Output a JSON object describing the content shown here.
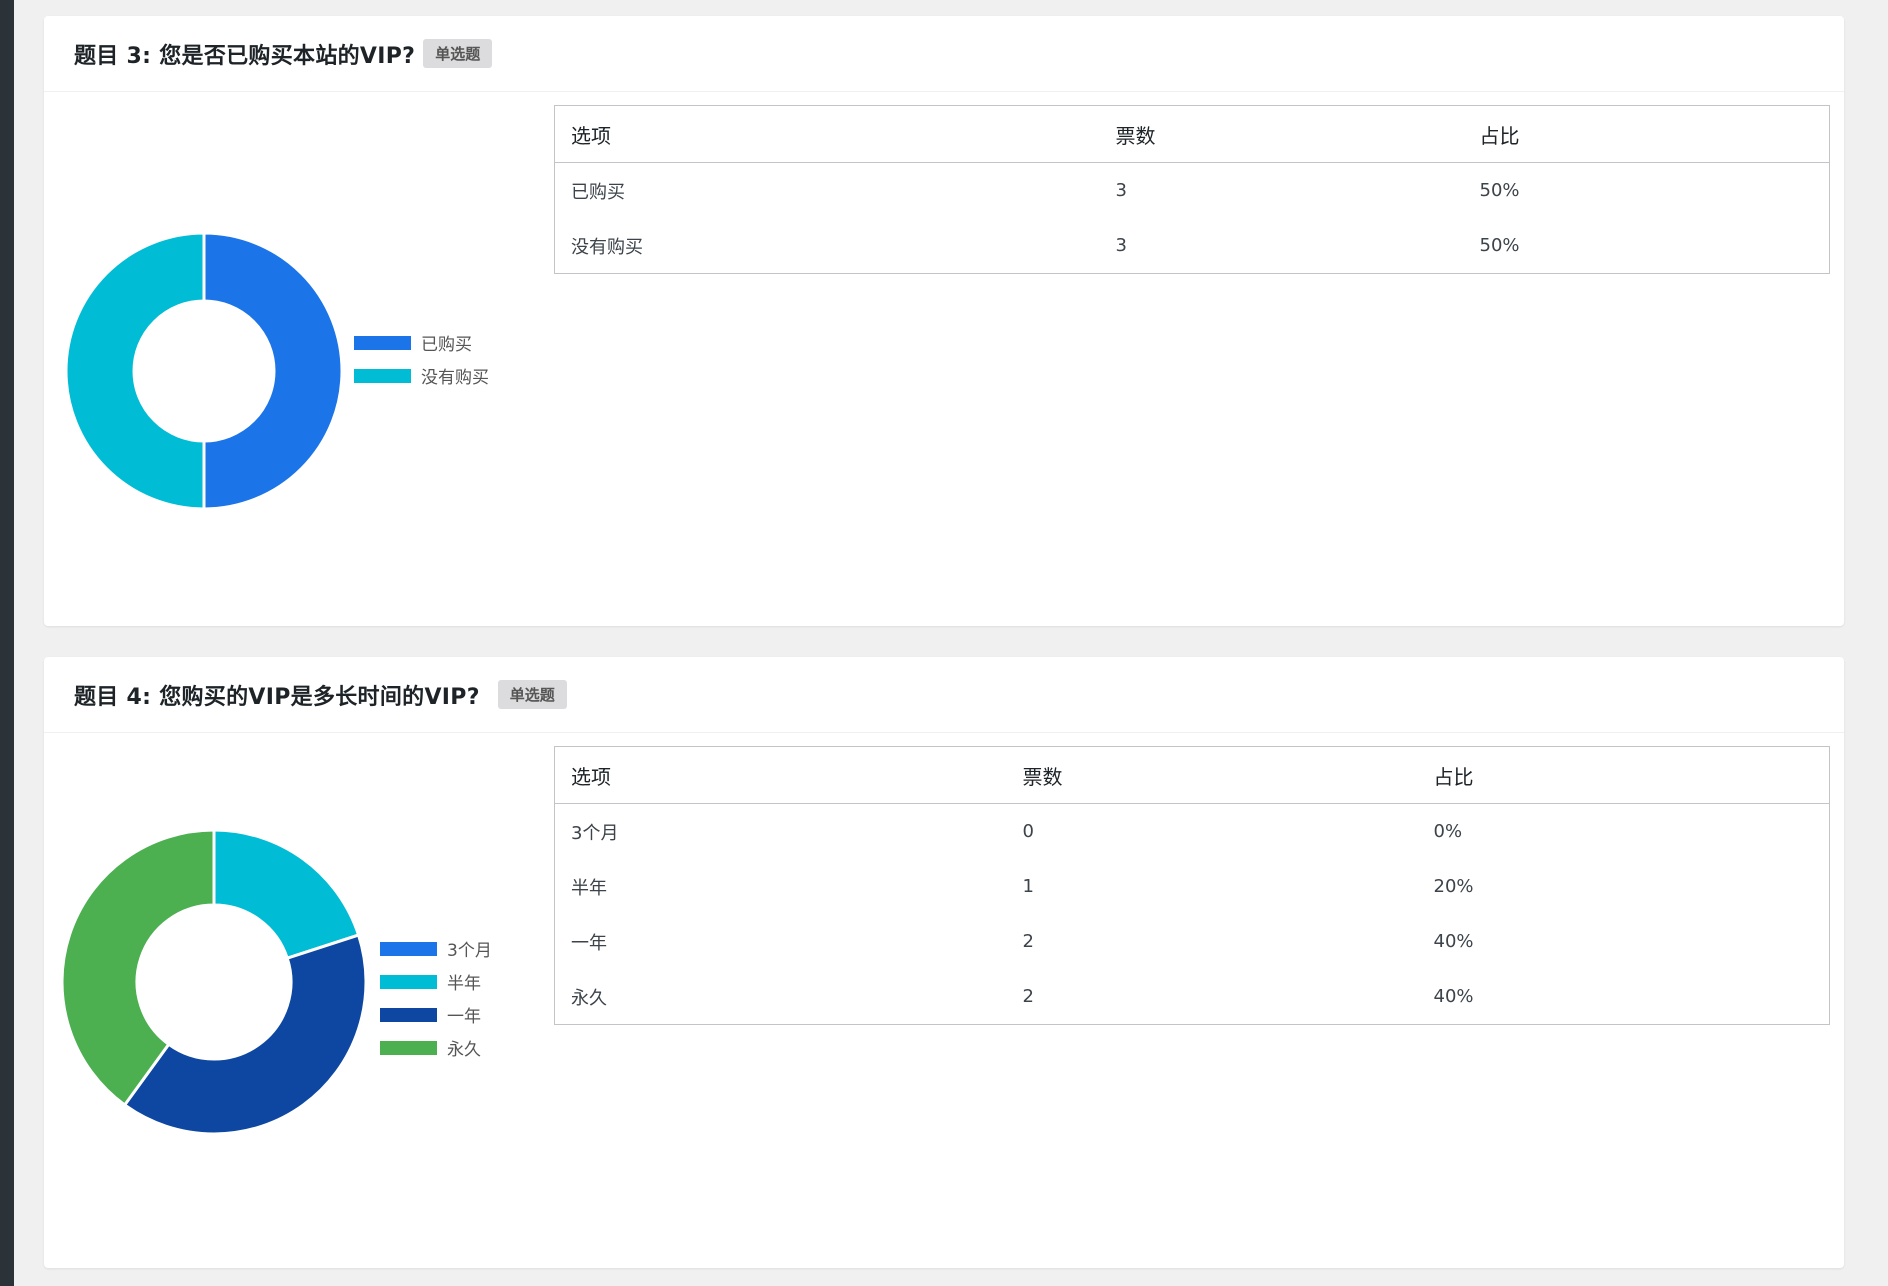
{
  "questions": [
    {
      "title": "题目 3: 您是否已购买本站的VIP?",
      "tag": "单选题",
      "table": {
        "headers": [
          "选项",
          "票数",
          "占比"
        ],
        "rows": [
          [
            "已购买",
            "3",
            "50%"
          ],
          [
            "没有购买",
            "3",
            "50%"
          ]
        ]
      },
      "chart_data": {
        "type": "pie",
        "categories": [
          "已购买",
          "没有购买"
        ],
        "values": [
          3,
          3
        ],
        "colors": [
          "#1b74e8",
          "#00bcd4"
        ],
        "legend": "right"
      }
    },
    {
      "title": "题目 4: 您购买的VIP是多长时间的VIP?",
      "tag": "单选题",
      "table": {
        "headers": [
          "选项",
          "票数",
          "占比"
        ],
        "rows": [
          [
            "3个月",
            "0",
            "0%"
          ],
          [
            "半年",
            "1",
            "20%"
          ],
          [
            "一年",
            "2",
            "40%"
          ],
          [
            "永久",
            "2",
            "40%"
          ]
        ]
      },
      "chart_data": {
        "type": "pie",
        "categories": [
          "3个月",
          "半年",
          "一年",
          "永久"
        ],
        "values": [
          0,
          1,
          2,
          2
        ],
        "colors": [
          "#1b74e8",
          "#00bcd4",
          "#0d47a1",
          "#4caf50"
        ],
        "legend": "right"
      }
    }
  ]
}
